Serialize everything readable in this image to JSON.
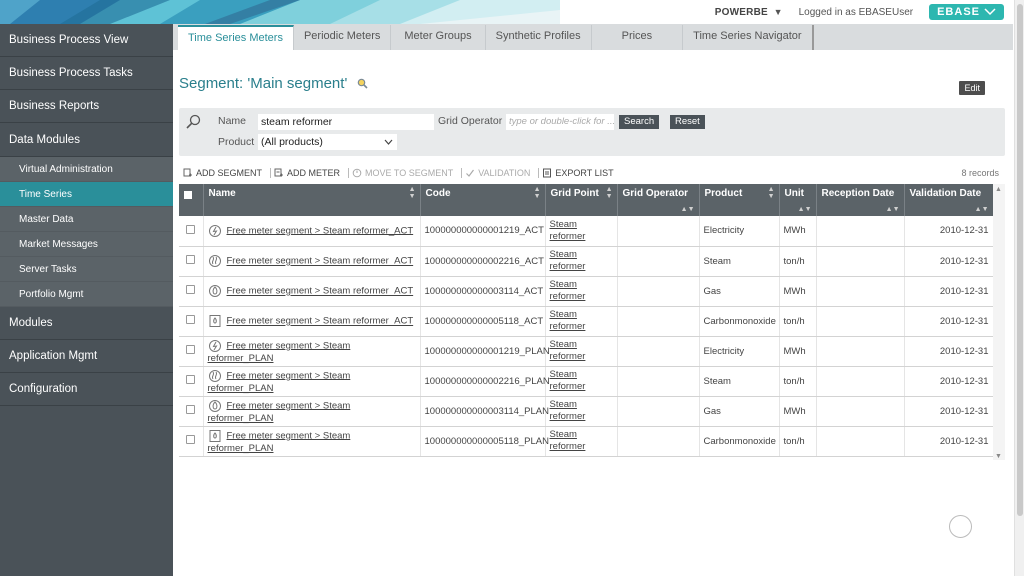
{
  "header": {
    "environment": "POWERBE",
    "environment_caret": "▼",
    "logged_in": "Logged in as EBASEUser",
    "logo": "EBASE"
  },
  "sidebar": {
    "items": [
      {
        "label": "Business Process View",
        "level": "main"
      },
      {
        "label": "Business Process Tasks",
        "level": "main"
      },
      {
        "label": "Business Reports",
        "level": "main"
      },
      {
        "label": "Data Modules",
        "level": "main"
      },
      {
        "label": "Virtual Administration",
        "level": "sub"
      },
      {
        "label": "Time Series",
        "level": "sub",
        "active": true
      },
      {
        "label": "Master Data",
        "level": "sub"
      },
      {
        "label": "Market Messages",
        "level": "sub"
      },
      {
        "label": "Server Tasks",
        "level": "sub"
      },
      {
        "label": "Portfolio Mgmt",
        "level": "sub"
      },
      {
        "label": "Modules",
        "level": "main"
      },
      {
        "label": "Application Mgmt",
        "level": "main"
      },
      {
        "label": "Configuration",
        "level": "main"
      }
    ]
  },
  "tabs": [
    {
      "label": "Time Series Meters",
      "active": true
    },
    {
      "label": "Periodic Meters"
    },
    {
      "label": "Meter Groups"
    },
    {
      "label": "Synthetic Profiles"
    },
    {
      "label": "Prices"
    },
    {
      "label": "Time Series Navigator"
    }
  ],
  "segment": {
    "title": "Segment: 'Main segment'",
    "edit_label": "Edit"
  },
  "filter": {
    "name_label": "Name",
    "name_value": "steam reformer",
    "grid_operator_label": "Grid Operator",
    "grid_operator_placeholder": "type or double-click for ...",
    "search_label": "Search",
    "reset_label": "Reset",
    "product_label": "Product",
    "product_value": "(All products)"
  },
  "toolbar": {
    "add_segment": "ADD SEGMENT",
    "add_meter": "ADD METER",
    "move_to_segment": "MOVE TO SEGMENT",
    "validation": "VALIDATION",
    "export_list": "EXPORT LIST",
    "records": "8 records"
  },
  "table": {
    "columns": [
      "Name",
      "Code",
      "Grid Point",
      "Grid Operator",
      "Product",
      "Unit",
      "Reception Date",
      "Validation Date"
    ],
    "rows": [
      {
        "icon": "electricity-icon",
        "name": "Free meter segment > Steam reformer_ACT",
        "code": "100000000000001219_ACT",
        "grid_point": [
          "Steam",
          "reformer"
        ],
        "grid_operator": "",
        "product": "Electricity",
        "unit": "MWh",
        "reception_date": "",
        "validation_date": "2010-12-31"
      },
      {
        "icon": "steam-icon",
        "name": "Free meter segment > Steam reformer_ACT",
        "code": "100000000000002216_ACT",
        "grid_point": [
          "Steam",
          "reformer"
        ],
        "grid_operator": "",
        "product": "Steam",
        "unit": "ton/h",
        "reception_date": "",
        "validation_date": "2010-12-31"
      },
      {
        "icon": "gas-icon",
        "name": "Free meter segment > Steam reformer_ACT",
        "code": "100000000000003114_ACT",
        "grid_point": [
          "Steam",
          "reformer"
        ],
        "grid_operator": "",
        "product": "Gas",
        "unit": "MWh",
        "reception_date": "",
        "validation_date": "2010-12-31"
      },
      {
        "icon": "co-icon",
        "name": "Free meter segment > Steam reformer_ACT",
        "code": "100000000000005118_ACT",
        "grid_point": [
          "Steam",
          "reformer"
        ],
        "grid_operator": "",
        "product": "Carbonmonoxide",
        "unit": "ton/h",
        "reception_date": "",
        "validation_date": "2010-12-31"
      },
      {
        "icon": "electricity-icon",
        "name": "Free meter segment > Steam reformer_PLAN",
        "code": "100000000000001219_PLAN",
        "grid_point": [
          "Steam",
          "reformer"
        ],
        "grid_operator": "",
        "product": "Electricity",
        "unit": "MWh",
        "reception_date": "",
        "validation_date": "2010-12-31"
      },
      {
        "icon": "steam-icon",
        "name": "Free meter segment > Steam reformer_PLAN",
        "code": "100000000000002216_PLAN",
        "grid_point": [
          "Steam",
          "reformer"
        ],
        "grid_operator": "",
        "product": "Steam",
        "unit": "ton/h",
        "reception_date": "",
        "validation_date": "2010-12-31"
      },
      {
        "icon": "gas-icon",
        "name": "Free meter segment > Steam reformer_PLAN",
        "code": "100000000000003114_PLAN",
        "grid_point": [
          "Steam",
          "reformer"
        ],
        "grid_operator": "",
        "product": "Gas",
        "unit": "MWh",
        "reception_date": "",
        "validation_date": "2010-12-31"
      },
      {
        "icon": "co-icon",
        "name": "Free meter segment > Steam reformer_PLAN",
        "code": "100000000000005118_PLAN",
        "grid_point": [
          "Steam",
          "reformer"
        ],
        "grid_operator": "",
        "product": "Carbonmonoxide",
        "unit": "ton/h",
        "reception_date": "",
        "validation_date": "2010-12-31"
      }
    ]
  },
  "colors": {
    "accent": "#2a8f9a",
    "sidebar_bg": "#4a5258",
    "header_bg": "#5b6368"
  }
}
